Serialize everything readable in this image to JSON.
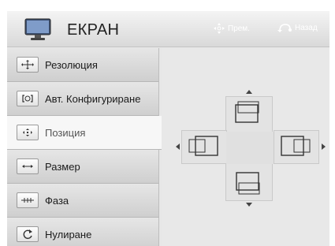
{
  "header": {
    "title": "ЕКРАН",
    "move_hint": "Прем.",
    "back_hint": "Назад",
    "icon": "monitor-icon"
  },
  "menu": {
    "items": [
      {
        "label": "Резолюция",
        "icon": "resolution-icon",
        "selected": false
      },
      {
        "label": "Авт. Конфигуриране",
        "icon": "auto-config-icon",
        "selected": false
      },
      {
        "label": "Позиция",
        "icon": "position-icon",
        "selected": true
      },
      {
        "label": "Размер",
        "icon": "size-icon",
        "selected": false
      },
      {
        "label": "Фаза",
        "icon": "phase-icon",
        "selected": false
      },
      {
        "label": "Нулиране",
        "icon": "reset-icon",
        "selected": false
      }
    ]
  },
  "colors": {
    "panel_bg": "#e7e7e7",
    "header_bg": "#e3e3e3",
    "selected_bg": "#f7f7f7",
    "icon_stroke": "#333333"
  }
}
